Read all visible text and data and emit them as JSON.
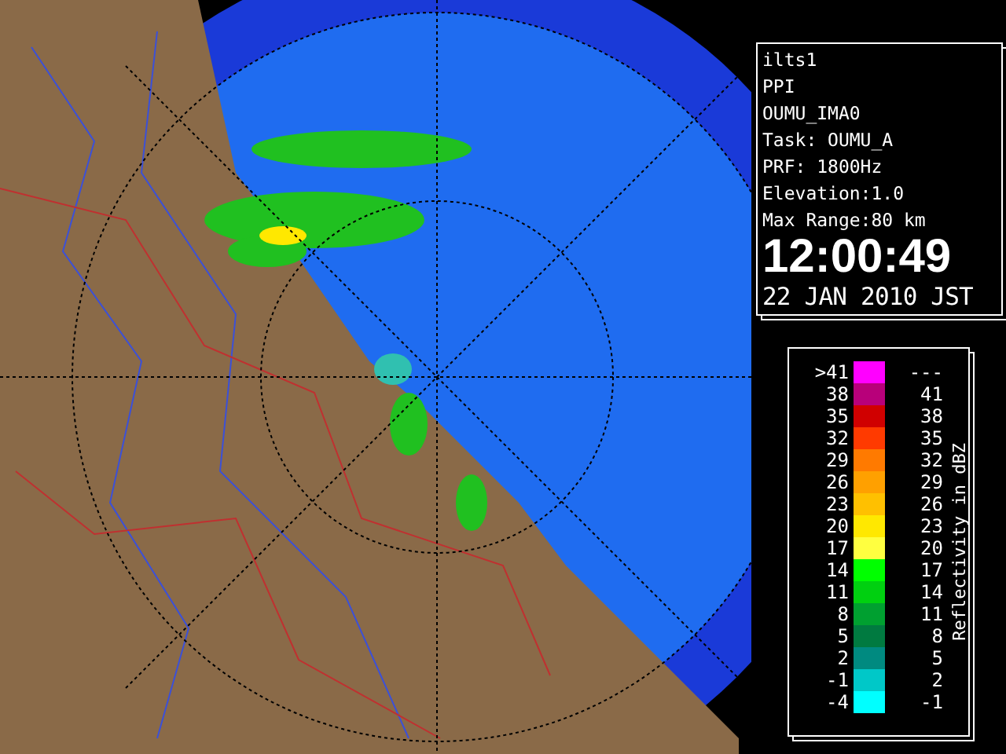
{
  "info_panel": {
    "lines": [
      "ilts1",
      "PPI",
      "OUMU_IMA0",
      "Task: OUMU_A",
      "PRF: 1800Hz",
      "Elevation:1.0",
      "Max Range:80 km"
    ],
    "time": "12:00:49",
    "date": "22 JAN 2010 JST"
  },
  "legend": {
    "title": "Reflectivity in dBZ",
    "rows": [
      {
        "low": ">41",
        "high": "---",
        "color": "#ff00ff"
      },
      {
        "low": "38",
        "high": "41",
        "color": "#b8007a"
      },
      {
        "low": "35",
        "high": "38",
        "color": "#d00000"
      },
      {
        "low": "32",
        "high": "35",
        "color": "#ff3a00"
      },
      {
        "low": "29",
        "high": "32",
        "color": "#ff7a00"
      },
      {
        "low": "26",
        "high": "29",
        "color": "#ffa000"
      },
      {
        "low": "23",
        "high": "26",
        "color": "#ffc000"
      },
      {
        "low": "20",
        "high": "23",
        "color": "#ffe800"
      },
      {
        "low": "17",
        "high": "20",
        "color": "#ffff40"
      },
      {
        "low": "14",
        "high": "17",
        "color": "#00ff00"
      },
      {
        "low": "11",
        "high": "14",
        "color": "#00d010"
      },
      {
        "low": "8",
        "high": "11",
        "color": "#00a030"
      },
      {
        "low": "5",
        "high": "8",
        "color": "#007a40"
      },
      {
        "low": "2",
        "high": "5",
        "color": "#008a80"
      },
      {
        "low": "-1",
        "high": "2",
        "color": "#00c8c8"
      },
      {
        "low": "-4",
        "high": "-1",
        "color": "#00ffff"
      }
    ]
  }
}
